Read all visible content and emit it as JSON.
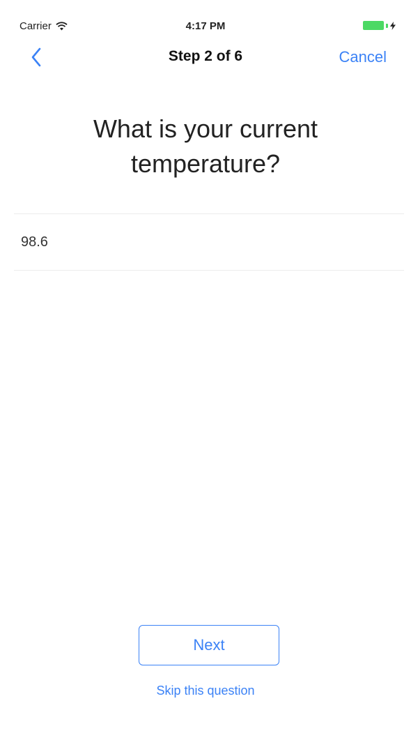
{
  "status_bar": {
    "carrier": "Carrier",
    "time": "4:17 PM",
    "battery_color": "#4cd964"
  },
  "nav": {
    "back_icon": "chevron-left-icon",
    "title": "Step 2 of 6",
    "cancel_label": "Cancel"
  },
  "question": {
    "text": "What is your current temperature?"
  },
  "answer": {
    "value": "98.6",
    "placeholder": ""
  },
  "actions": {
    "next_label": "Next",
    "skip_label": "Skip this question"
  },
  "colors": {
    "accent": "#3b82f6"
  }
}
